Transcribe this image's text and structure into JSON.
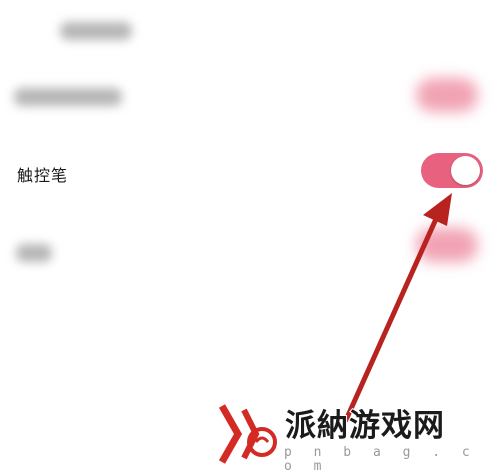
{
  "settings": {
    "rows": [
      {
        "label": "触控笔",
        "toggle_state": "on"
      }
    ]
  },
  "watermark": {
    "name": "派納游戏网",
    "domain": "p n b a g . c o m"
  },
  "colors": {
    "toggle_on": "#e8627f",
    "toggle_blurred": "#f1a3b4",
    "arrow": "#b8231f",
    "background": "#ffffff"
  },
  "icons": [
    "toggle-knob",
    "annotation-arrow",
    "watermark-logo"
  ]
}
